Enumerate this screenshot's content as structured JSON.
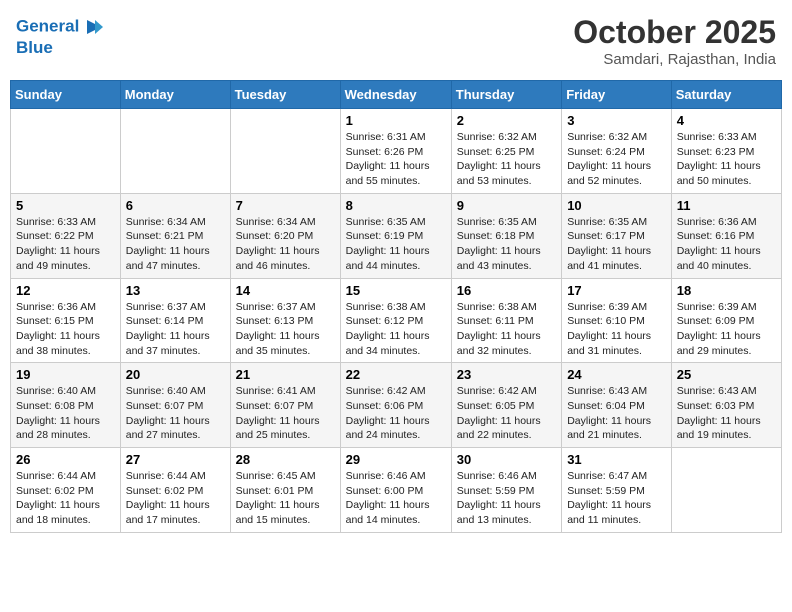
{
  "header": {
    "logo_line1": "General",
    "logo_line2": "Blue",
    "month": "October 2025",
    "location": "Samdari, Rajasthan, India"
  },
  "days_of_week": [
    "Sunday",
    "Monday",
    "Tuesday",
    "Wednesday",
    "Thursday",
    "Friday",
    "Saturday"
  ],
  "weeks": [
    [
      {
        "day": "",
        "sunrise": "",
        "sunset": "",
        "daylight": ""
      },
      {
        "day": "",
        "sunrise": "",
        "sunset": "",
        "daylight": ""
      },
      {
        "day": "",
        "sunrise": "",
        "sunset": "",
        "daylight": ""
      },
      {
        "day": "1",
        "sunrise": "6:31 AM",
        "sunset": "6:26 PM",
        "daylight": "11 hours and 55 minutes."
      },
      {
        "day": "2",
        "sunrise": "6:32 AM",
        "sunset": "6:25 PM",
        "daylight": "11 hours and 53 minutes."
      },
      {
        "day": "3",
        "sunrise": "6:32 AM",
        "sunset": "6:24 PM",
        "daylight": "11 hours and 52 minutes."
      },
      {
        "day": "4",
        "sunrise": "6:33 AM",
        "sunset": "6:23 PM",
        "daylight": "11 hours and 50 minutes."
      }
    ],
    [
      {
        "day": "5",
        "sunrise": "6:33 AM",
        "sunset": "6:22 PM",
        "daylight": "11 hours and 49 minutes."
      },
      {
        "day": "6",
        "sunrise": "6:34 AM",
        "sunset": "6:21 PM",
        "daylight": "11 hours and 47 minutes."
      },
      {
        "day": "7",
        "sunrise": "6:34 AM",
        "sunset": "6:20 PM",
        "daylight": "11 hours and 46 minutes."
      },
      {
        "day": "8",
        "sunrise": "6:35 AM",
        "sunset": "6:19 PM",
        "daylight": "11 hours and 44 minutes."
      },
      {
        "day": "9",
        "sunrise": "6:35 AM",
        "sunset": "6:18 PM",
        "daylight": "11 hours and 43 minutes."
      },
      {
        "day": "10",
        "sunrise": "6:35 AM",
        "sunset": "6:17 PM",
        "daylight": "11 hours and 41 minutes."
      },
      {
        "day": "11",
        "sunrise": "6:36 AM",
        "sunset": "6:16 PM",
        "daylight": "11 hours and 40 minutes."
      }
    ],
    [
      {
        "day": "12",
        "sunrise": "6:36 AM",
        "sunset": "6:15 PM",
        "daylight": "11 hours and 38 minutes."
      },
      {
        "day": "13",
        "sunrise": "6:37 AM",
        "sunset": "6:14 PM",
        "daylight": "11 hours and 37 minutes."
      },
      {
        "day": "14",
        "sunrise": "6:37 AM",
        "sunset": "6:13 PM",
        "daylight": "11 hours and 35 minutes."
      },
      {
        "day": "15",
        "sunrise": "6:38 AM",
        "sunset": "6:12 PM",
        "daylight": "11 hours and 34 minutes."
      },
      {
        "day": "16",
        "sunrise": "6:38 AM",
        "sunset": "6:11 PM",
        "daylight": "11 hours and 32 minutes."
      },
      {
        "day": "17",
        "sunrise": "6:39 AM",
        "sunset": "6:10 PM",
        "daylight": "11 hours and 31 minutes."
      },
      {
        "day": "18",
        "sunrise": "6:39 AM",
        "sunset": "6:09 PM",
        "daylight": "11 hours and 29 minutes."
      }
    ],
    [
      {
        "day": "19",
        "sunrise": "6:40 AM",
        "sunset": "6:08 PM",
        "daylight": "11 hours and 28 minutes."
      },
      {
        "day": "20",
        "sunrise": "6:40 AM",
        "sunset": "6:07 PM",
        "daylight": "11 hours and 27 minutes."
      },
      {
        "day": "21",
        "sunrise": "6:41 AM",
        "sunset": "6:07 PM",
        "daylight": "11 hours and 25 minutes."
      },
      {
        "day": "22",
        "sunrise": "6:42 AM",
        "sunset": "6:06 PM",
        "daylight": "11 hours and 24 minutes."
      },
      {
        "day": "23",
        "sunrise": "6:42 AM",
        "sunset": "6:05 PM",
        "daylight": "11 hours and 22 minutes."
      },
      {
        "day": "24",
        "sunrise": "6:43 AM",
        "sunset": "6:04 PM",
        "daylight": "11 hours and 21 minutes."
      },
      {
        "day": "25",
        "sunrise": "6:43 AM",
        "sunset": "6:03 PM",
        "daylight": "11 hours and 19 minutes."
      }
    ],
    [
      {
        "day": "26",
        "sunrise": "6:44 AM",
        "sunset": "6:02 PM",
        "daylight": "11 hours and 18 minutes."
      },
      {
        "day": "27",
        "sunrise": "6:44 AM",
        "sunset": "6:02 PM",
        "daylight": "11 hours and 17 minutes."
      },
      {
        "day": "28",
        "sunrise": "6:45 AM",
        "sunset": "6:01 PM",
        "daylight": "11 hours and 15 minutes."
      },
      {
        "day": "29",
        "sunrise": "6:46 AM",
        "sunset": "6:00 PM",
        "daylight": "11 hours and 14 minutes."
      },
      {
        "day": "30",
        "sunrise": "6:46 AM",
        "sunset": "5:59 PM",
        "daylight": "11 hours and 13 minutes."
      },
      {
        "day": "31",
        "sunrise": "6:47 AM",
        "sunset": "5:59 PM",
        "daylight": "11 hours and 11 minutes."
      },
      {
        "day": "",
        "sunrise": "",
        "sunset": "",
        "daylight": ""
      }
    ]
  ]
}
